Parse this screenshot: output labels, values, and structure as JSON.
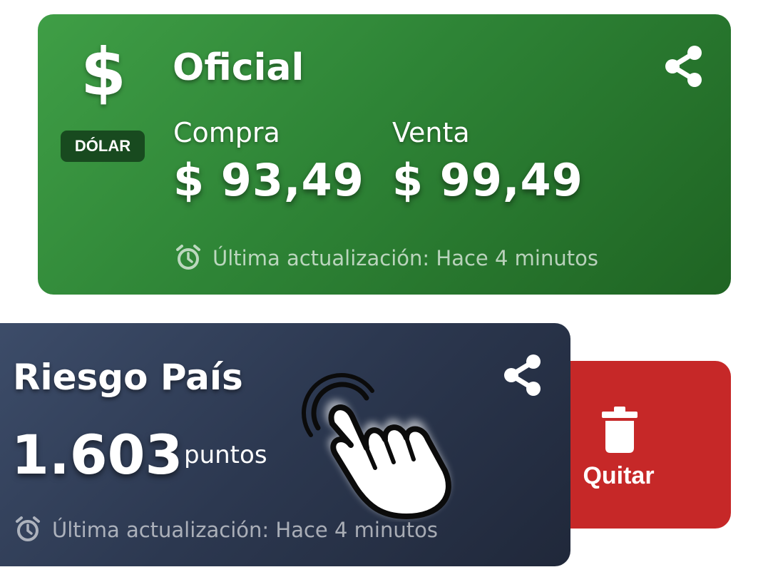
{
  "cards": {
    "dolar": {
      "icon": "dollar-sign-icon",
      "symbol": "$",
      "badge": "DÓLAR",
      "title": "Oficial",
      "compra_label": "Compra",
      "compra_value": "$ 93,49",
      "venta_label": "Venta",
      "venta_value": "$ 99,49",
      "updated": "Última actualización: Hace 4 minutos"
    },
    "riesgo": {
      "title": "Riesgo País",
      "value": "1.603",
      "unit": "puntos",
      "updated": "Última actualización: Hace 4 minutos"
    },
    "swipe_action": {
      "label": "Quitar",
      "icon": "trash-icon"
    },
    "gesture": {
      "icon": "tap-hand-icon"
    }
  },
  "colors": {
    "green": "#2e8436",
    "badge": "#184a1f",
    "navy": "#2c3850",
    "red": "#c62828"
  }
}
